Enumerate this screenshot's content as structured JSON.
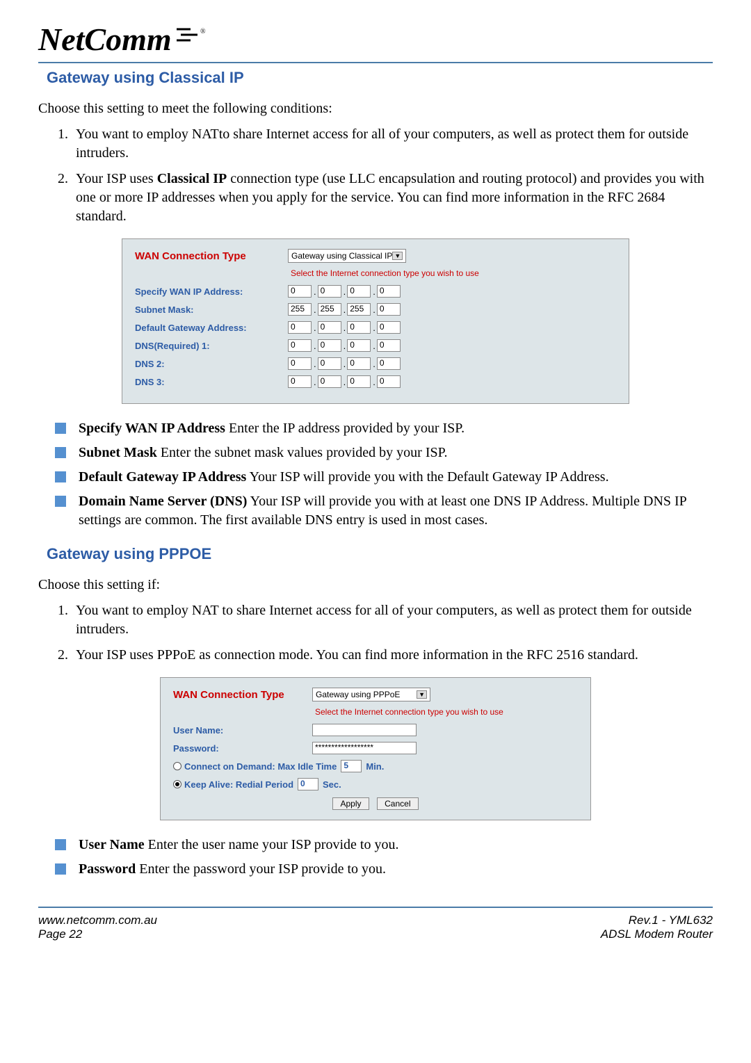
{
  "logo": {
    "brand": "NetComm",
    "reg": "®"
  },
  "s1": {
    "title": "Gateway using Classical IP",
    "intro": "Choose this setting to meet the following conditions:",
    "li1": "You want to employ NATto share Internet access for all of your computers, as well as protect them for outside intruders.",
    "li2_a": "Your ISP uses ",
    "li2_b": "Classical IP",
    "li2_c": " connection type (use LLC encapsulation and routing protocol) and provides you with one or more IP addresses when you apply for the service. You can find more information in the RFC 2684 standard."
  },
  "shot1": {
    "wct": "WAN Connection Type",
    "sel": "Gateway using Classical IP",
    "note": "Select the Internet connection type you wish to use",
    "f1": "Specify WAN IP Address:",
    "f2": "Subnet Mask:",
    "f3": "Default Gateway Address:",
    "f4": "DNS(Required)  1:",
    "f5": "DNS   2:",
    "f6": "DNS   3:",
    "ip0": "0",
    "ip255": "255"
  },
  "b1": {
    "a1": "Specify WAN IP Address",
    "a2": " Enter the IP address provided by your ISP.",
    "b1": "Subnet Mask",
    "b2": " Enter the subnet mask values provided by your ISP.",
    "c1": "Default Gateway IP Address",
    "c2": " Your ISP will provide you with the Default Gateway IP Address.",
    "d1": "Domain Name Server (DNS)",
    "d2": " Your ISP will provide you with at least one DNS IP Address. Multiple DNS IP settings are common. The first available DNS entry is used in most cases."
  },
  "s2": {
    "title": "Gateway using PPPOE",
    "intro": "Choose this setting if:",
    "li1": "You want to employ NAT to share Internet access for all of your computers, as well as protect them for outside intruders.",
    "li2": "Your ISP uses PPPoE as connection mode. You can find more information in the RFC 2516 standard."
  },
  "shot2": {
    "wct": "WAN Connection Type",
    "sel": "Gateway using PPPoE",
    "note": "Select the Internet connection type you wish to use",
    "f1": "User Name:",
    "f2": "Password:",
    "pw": "******************",
    "r1a": "Connect on Demand: Max Idle Time ",
    "r1v": "5",
    "r1b": "Min.",
    "r2a": "Keep Alive: Redial Period ",
    "r2v": "0",
    "r2b": "Sec.",
    "btn1": "Apply",
    "btn2": "Cancel"
  },
  "b2": {
    "a1": "User Name",
    "a2": " Enter the user name your ISP provide to you.",
    "b1": "Password",
    "b2": " Enter the password your ISP provide to you."
  },
  "footer": {
    "url": "www.netcomm.com.au",
    "rev": "Rev.1 - YML632",
    "page": "Page 22",
    "prod": "ADSL Modem Router"
  }
}
